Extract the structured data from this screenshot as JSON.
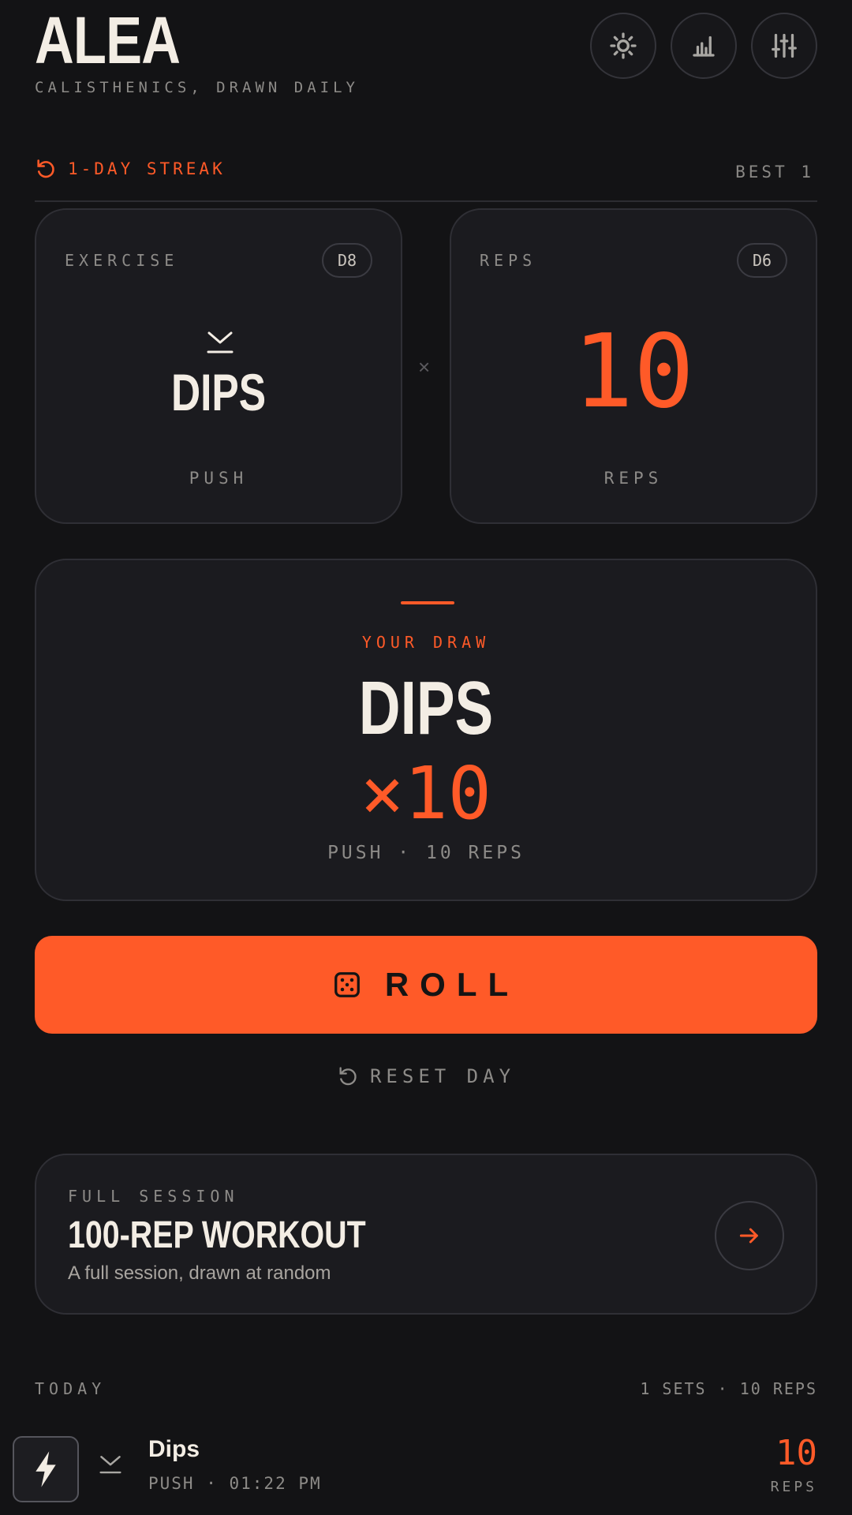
{
  "app": {
    "title": "ALEA",
    "tagline": "CALISTHENICS, DRAWN DAILY"
  },
  "header": {
    "icons": [
      "sun-icon",
      "bar-chart-icon",
      "sliders-icon"
    ]
  },
  "streak": {
    "label": "1-DAY STREAK",
    "best": "BEST 1"
  },
  "exercise_card": {
    "label": "EXERCISE",
    "die": "D8",
    "exercise": "DIPS",
    "category": "PUSH"
  },
  "reps_card": {
    "label": "REPS",
    "die": "D6",
    "value": "10",
    "unit": "REPS"
  },
  "separator": "×",
  "draw": {
    "label": "YOUR DRAW",
    "exercise": "DIPS",
    "multiplier": "×10",
    "summary": "PUSH · 10 REPS"
  },
  "roll_button": {
    "label": "ROLL"
  },
  "reset": {
    "label": "RESET DAY"
  },
  "session": {
    "eyebrow": "FULL SESSION",
    "title": "100-REP WORKOUT",
    "description": "A full session, drawn at random"
  },
  "today": {
    "label": "TODAY",
    "stats": "1 SETS · 10 REPS",
    "entries": [
      {
        "name": "Dips",
        "meta": "PUSH · 01:22 PM",
        "reps": "10",
        "reps_unit": "REPS"
      }
    ]
  },
  "colors": {
    "background": "#131315",
    "accent": "#ff5a28",
    "card": "#1b1b1f",
    "text": "#f3ede4",
    "muted": "#8d8b88"
  }
}
